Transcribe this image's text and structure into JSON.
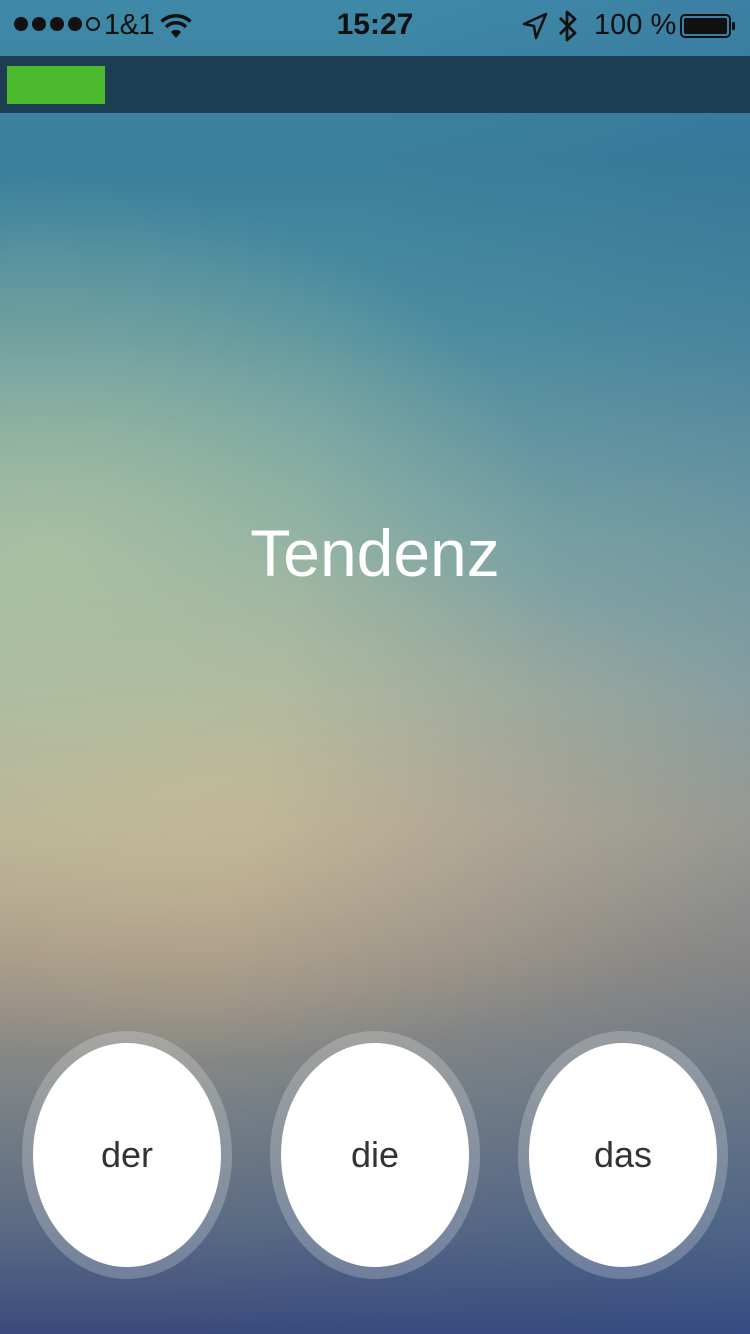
{
  "status_bar": {
    "carrier": "1&1",
    "time": "15:27",
    "battery_percent": "100 %",
    "signal_bars_filled": 4,
    "signal_bars_total": 5,
    "icons": [
      "signal-dots-icon",
      "wifi-icon",
      "location-arrow-icon",
      "bluetooth-icon",
      "battery-icon"
    ]
  },
  "progress": {
    "fraction": 0.13,
    "color": "#4cba2f",
    "track_color": "#1d3d52"
  },
  "word": "Tendenz",
  "articles": [
    "der",
    "die",
    "das"
  ]
}
